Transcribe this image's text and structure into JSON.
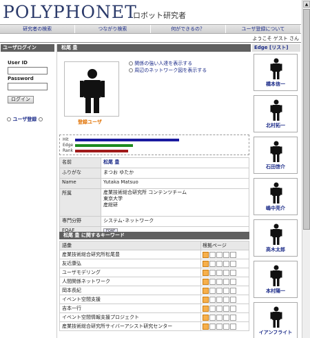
{
  "header": {
    "logo": "POLYPHONET",
    "subtitle": "ロボット研究者",
    "welcome": "ようこそ ゲスト さん"
  },
  "nav": [
    "研究者の検索",
    "つながり検索",
    "何ができるの？",
    "ユーザ登録について"
  ],
  "login": {
    "title": "ユーザログイン",
    "user_label": "User ID",
    "password_label": "Password",
    "button": "ログイン",
    "register": "ユーザ登録"
  },
  "profile": {
    "title": "松尾 豊",
    "registered_label": "登録ユーザ",
    "link_strong": "関係の強い人達を表示する",
    "link_network": "周辺のネットワーク図を表示する",
    "bars": [
      {
        "label": "Hit",
        "value": 0.63,
        "color": "#1a1aa0"
      },
      {
        "label": "Edge",
        "value": 0.35,
        "color": "#1e8a1e"
      },
      {
        "label": "Rank",
        "value": 0.32,
        "color": "#a01a1a"
      }
    ],
    "fields": [
      {
        "key": "名前",
        "value": "松尾 豊"
      },
      {
        "key": "ふりがな",
        "value": "まつお ゆたか"
      },
      {
        "key": "Name",
        "value": "Yutaka Matsuo"
      },
      {
        "key": "所属",
        "value": "産業技術総合研究所 コンテンツチーム\n東京大学\n産総研"
      },
      {
        "key": "専門分野",
        "value": "システム･ネットワーク"
      },
      {
        "key": "FOAF",
        "value": "FOAF"
      }
    ]
  },
  "keywords": {
    "title": "松尾 豊 に関するキーワード",
    "col_word": "語彙",
    "col_pages": "根拠ページ",
    "rows": [
      "産業技術総合研究所松尾豊",
      "友近康弘",
      "ユーザモデリング",
      "人間関係ネットワーク",
      "岡本長紀",
      "イベント空間支援",
      "吉本一行",
      "イベント空間情報支援プロジェクト",
      "産業技術総合研究所サイバーアシスト研究センター"
    ]
  },
  "edges": {
    "title": "Edge",
    "list_link": "[リスト]",
    "people": [
      "橋本信一",
      "北村拓一",
      "石田啓介",
      "嶋中亮介",
      "高木太郎",
      "本村陽一",
      "イアンフライト"
    ]
  }
}
